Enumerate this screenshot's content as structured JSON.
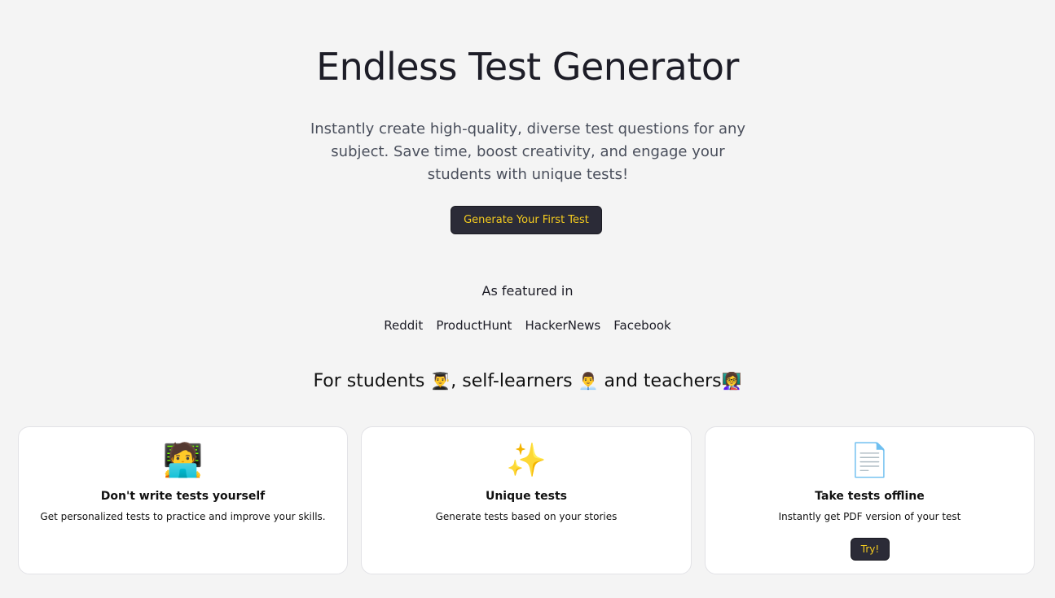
{
  "hero": {
    "title": "Endless Test Generator",
    "subtitle": "Instantly create high-quality, diverse test questions for any subject. Save time, boost creativity, and engage your students with unique tests!",
    "cta_label": "Generate Your First Test"
  },
  "featured": {
    "label": "As featured in",
    "links": [
      "Reddit",
      "ProductHunt",
      "HackerNews",
      "Facebook"
    ]
  },
  "audience": {
    "text_1": "For students ",
    "emoji_1": "👨‍🎓",
    "text_2": ", self-learners ",
    "emoji_2": "👨‍💼",
    "text_3": " and teachers",
    "emoji_3": "👩‍🏫"
  },
  "cards": [
    {
      "icon": "🧑‍💻",
      "icon_name": "person-laptop-icon",
      "title": "Don't write tests yourself",
      "description": "Get personalized tests to practice and improve your skills."
    },
    {
      "icon": "✨",
      "icon_name": "sparkles-icon",
      "title": "Unique tests",
      "description": "Generate tests based on your stories"
    },
    {
      "icon": "📄",
      "icon_name": "document-icon",
      "title": "Take tests offline",
      "description": "Instantly get PDF version of your test",
      "button_label": "Try!"
    }
  ],
  "colors": {
    "background": "#f4f4f4",
    "button_bg": "#2b2b37",
    "button_text": "#f5cc1f",
    "card_bg": "#ffffff"
  }
}
